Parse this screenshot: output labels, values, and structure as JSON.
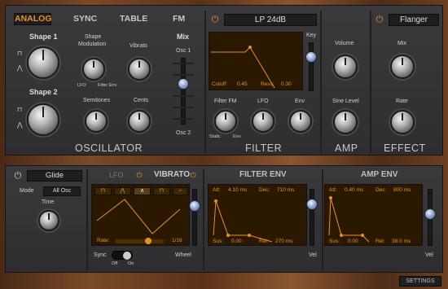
{
  "tabs": [
    "ANALOG",
    "SYNC",
    "TABLE",
    "FM"
  ],
  "oscillator": {
    "shape1": "Shape 1",
    "shape2": "Shape 2",
    "shape_mod": "Shape",
    "shape_mod2": "Modulation",
    "vibrato": "Vibrato",
    "lfo": "LFO",
    "filter_env": "Filter Env",
    "semitones": "Semitones",
    "cents": "Cents",
    "mix": "Mix",
    "osc1": "Osc 1",
    "osc2": "Osc 2",
    "title": "OSCILLATOR"
  },
  "filter": {
    "type": "LP 24dB",
    "key": "Key",
    "cutoff_label": "Cutoff:",
    "cutoff_val": "0.45",
    "reso_label": "Reso:",
    "reso_val": "0.30",
    "filter_fm": "Filter FM",
    "lfo": "LFO",
    "env": "Env",
    "static": "Static",
    "env2": "Env",
    "title": "FILTER"
  },
  "amp": {
    "volume": "Volume",
    "sine_level": "Sine Level",
    "title": "AMP"
  },
  "effect": {
    "type": "Flanger",
    "mix": "Mix",
    "rate": "Rate",
    "title": "EFFECT"
  },
  "glide": {
    "label": "Glide",
    "mode_label": "Mode",
    "mode_value": "All Osc",
    "time": "Time"
  },
  "lfo": {
    "lfo": "LFO",
    "vibrato": "VIBRATO",
    "rate_label": "Rate:",
    "rate_val": "1/16",
    "sync": "Sync",
    "off": "Off",
    "on": "On",
    "wheel": "Wheel"
  },
  "filter_env": {
    "title": "FILTER ENV",
    "att_l": "Att:",
    "att_v": "4.10 ms",
    "dec_l": "Dec:",
    "dec_v": "710 ms",
    "sus_l": "Sus:",
    "sus_v": "0.00",
    "rel_l": "Rel:",
    "rel_v": "270 ms",
    "vel": "Vel"
  },
  "amp_env": {
    "title": "AMP ENV",
    "att_l": "Att:",
    "att_v": "0.40 ms",
    "dec_l": "Dec:",
    "dec_v": "800 ms",
    "sus_l": "Sus:",
    "sus_v": "0.00",
    "rel_l": "Rel:",
    "rel_v": "38.0 ms",
    "vel": "Vel"
  },
  "settings": "SETTINGS",
  "icons": {
    "power": "power-icon",
    "wave_square": "square-wave-icon",
    "wave_saw": "saw-wave-icon",
    "wave_sine": "sine-wave-icon"
  },
  "colors": {
    "accent": "#e89030",
    "screen": "#2a1900",
    "wood": "#7a4a28"
  }
}
